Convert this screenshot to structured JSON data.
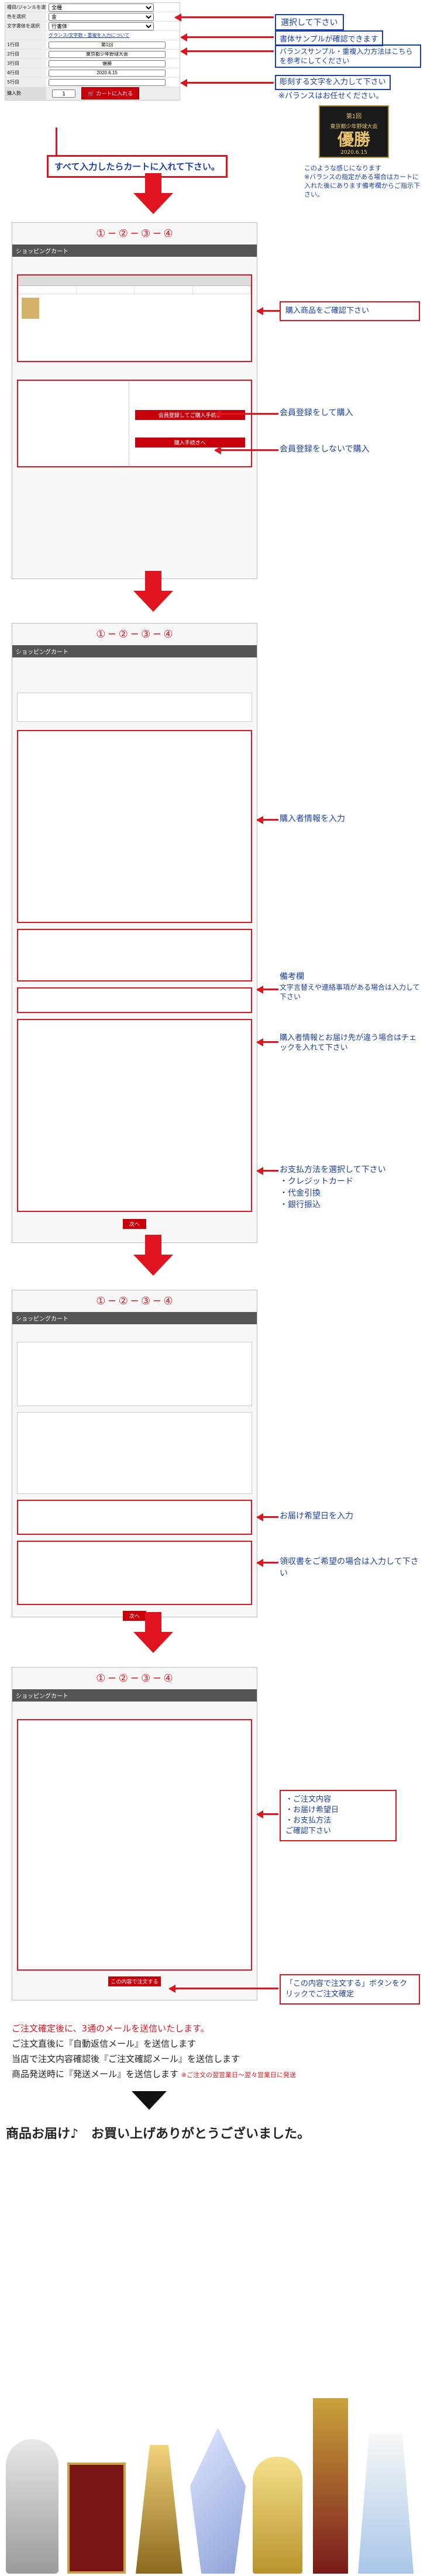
{
  "top_form": {
    "rows": [
      {
        "label": "種目/ジャンルを選択",
        "value": "全種"
      },
      {
        "label": "色を選択",
        "value": "金"
      },
      {
        "label": "文字書体を選択",
        "value": "行書体"
      },
      {
        "label": "",
        "value": "グランス/文字数・重複を入力について"
      },
      {
        "label": "1行目",
        "value": "第1回"
      },
      {
        "label": "2行目",
        "value": "東京都少年野球大会"
      },
      {
        "label": "3行目",
        "value": "優勝"
      },
      {
        "label": "4行目",
        "value": "2020.6.15"
      },
      {
        "label": "5行目",
        "value": ""
      }
    ],
    "quantity_label": "購入数",
    "quantity": "1",
    "cart_button": "カートに入れる",
    "font_link": "文字書体サンプル"
  },
  "callouts_top": {
    "select_hint": "選択して下さい",
    "font_sample": "書体サンプルが確認できます",
    "balance": "バランスサンプル・重複入力方法はこちらを参考にしてください",
    "engrave": "彫刻する文字を入力して下さい",
    "balance_note": "※バランスはお任せください。",
    "preview_note": "このような感じになります\n※バランスの指定がある場合はカートに入れた後にあります備考欄からご指示下さい。",
    "add_to_cart": "すべて入力したらカートに入れて下さい。"
  },
  "plate": {
    "line1": "第1回",
    "line2": "東京都少年野球大会",
    "line3": "優勝",
    "line4": "2020.6.15"
  },
  "step1": {
    "header": "ショッピングカート",
    "callout1": "購入商品をご確認下さい",
    "callout2": "会員登録をして購入",
    "callout3": "会員登録をしないで購入",
    "member_btn": "会員登録してご購入手続き",
    "guest_btn": "購入手続きへ"
  },
  "step2": {
    "header": "ショッピングカート",
    "callout1": "購入者情報を入力",
    "callout2_title": "備考欄",
    "callout2_body": "文字言替えや連絡事項がある場合は入力して下さい",
    "callout3": "購入者情報とお届け先が違う場合はチェックを入れて下さい",
    "callout4_title": "お支払方法を選択して下さい",
    "callout4_items": [
      "・クレジットカード",
      "・代金引換",
      "・銀行振込"
    ],
    "next_btn": "次へ"
  },
  "step3": {
    "header": "ショッピングカート",
    "callout1": "お届け希望日を入力",
    "callout2": "領収書をご希望の場合は入力して下さい",
    "next_btn": "次へ"
  },
  "step4": {
    "header": "ショッピングカート",
    "callout1": "・ご注文内容\n・お届け希望日\n・お支払方法\nご確認下さい",
    "callout2": "「この内容で注文する」ボタンをクリックでご注文確定",
    "confirm_btn": "この内容で注文する"
  },
  "footer": {
    "line1": "ご注文確定後に、3通のメールを送信いたします。",
    "line2": "ご注文直後に『自動返信メール』を送信します",
    "line3": "当店で注文内容確認後『ご注文確認メール』を送信します",
    "line4": "商品発送時に『発送メール』を送信します",
    "line4_note": "※ご注文の翌営業日〜翌々営業日に発送",
    "thanks": "商品お届け♪　お買い上げありがとうございました。"
  },
  "colors": {
    "accent": "#e0141e",
    "blue": "#1a3fa8",
    "cart_red": "#c7000b"
  },
  "icons": [
    "arrow-down-icon",
    "arrow-left-icon",
    "trophy-icon",
    "cart-icon"
  ]
}
